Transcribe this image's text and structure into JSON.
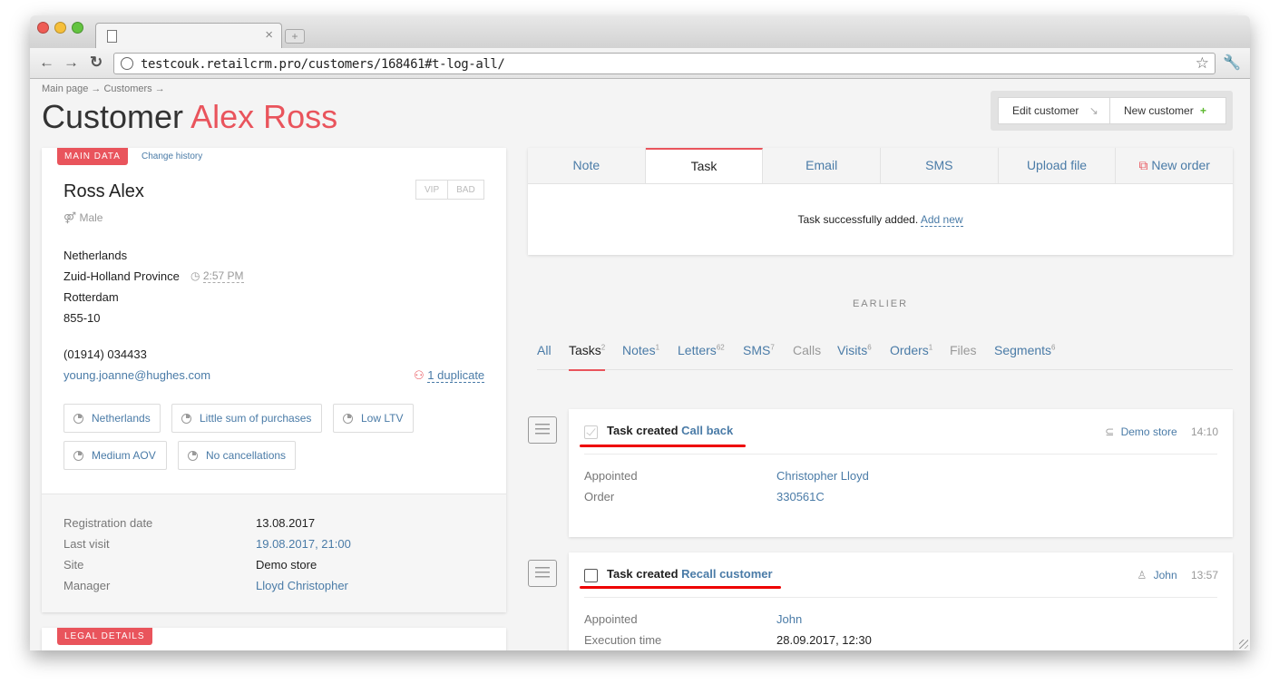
{
  "browser": {
    "url": "testcouk.retailcrm.pro/customers/168461#t-log-all/",
    "tab_close": "×",
    "new_tab": "+"
  },
  "page": {
    "breadcrumb": "Main page → Customers →",
    "title_prefix": "Customer",
    "title_name": "Alex Ross",
    "edit_customer": "Edit customer",
    "new_customer": "New customer"
  },
  "main_data": {
    "label": "MAIN DATA",
    "change_history": "Change history",
    "name": "Ross Alex",
    "vip": "VIP",
    "bad": "BAD",
    "gender": "Male",
    "country": "Netherlands",
    "region": "Zuid-Holland Province",
    "local_time": "2:57 PM",
    "city": "Rotterdam",
    "address": "855-10",
    "phone": "(01914) 034433",
    "email": "young.joanne@hughes.com",
    "duplicate": "1 duplicate",
    "segments": [
      "Netherlands",
      "Little sum of purchases",
      "Low LTV",
      "Medium AOV",
      "No cancellations"
    ]
  },
  "meta": {
    "registration_label": "Registration date",
    "registration_value": "13.08.2017",
    "last_visit_label": "Last visit",
    "last_visit_value": "19.08.2017, 21:00",
    "site_label": "Site",
    "site_value": "Demo store",
    "manager_label": "Manager",
    "manager_value": "Lloyd Christopher"
  },
  "legal": {
    "label": "LEGAL DETAILS"
  },
  "activity_tabs": [
    "Note",
    "Task",
    "Email",
    "SMS",
    "Upload file",
    "New order"
  ],
  "activity_active": "Task",
  "success": {
    "message": "Task successfully added.",
    "link": "Add new"
  },
  "earlier": "EARLIER",
  "filters": [
    {
      "label": "All",
      "count": ""
    },
    {
      "label": "Tasks",
      "count": "2"
    },
    {
      "label": "Notes",
      "count": "1"
    },
    {
      "label": "Letters",
      "count": "62"
    },
    {
      "label": "SMS",
      "count": "7"
    },
    {
      "label": "Calls",
      "count": ""
    },
    {
      "label": "Visits",
      "count": "6"
    },
    {
      "label": "Orders",
      "count": "1"
    },
    {
      "label": "Files",
      "count": ""
    },
    {
      "label": "Segments",
      "count": "6"
    }
  ],
  "log": [
    {
      "title_prefix": "Task created",
      "title_link": "Call back",
      "source": "Demo store",
      "time": "14:10",
      "rows": [
        {
          "label": "Appointed",
          "value": "Christopher Lloyd"
        },
        {
          "label": "Order",
          "value": "330561C"
        }
      ]
    },
    {
      "title_prefix": "Task created",
      "title_link": "Recall customer",
      "source": "John",
      "time": "13:57",
      "rows": [
        {
          "label": "Appointed",
          "value": "John"
        },
        {
          "label": "Execution time",
          "value": "28.09.2017, 12:30"
        }
      ]
    }
  ],
  "colors": {
    "accent": "#e9545c",
    "link": "#4a7ba7",
    "underline": "#e00000"
  }
}
